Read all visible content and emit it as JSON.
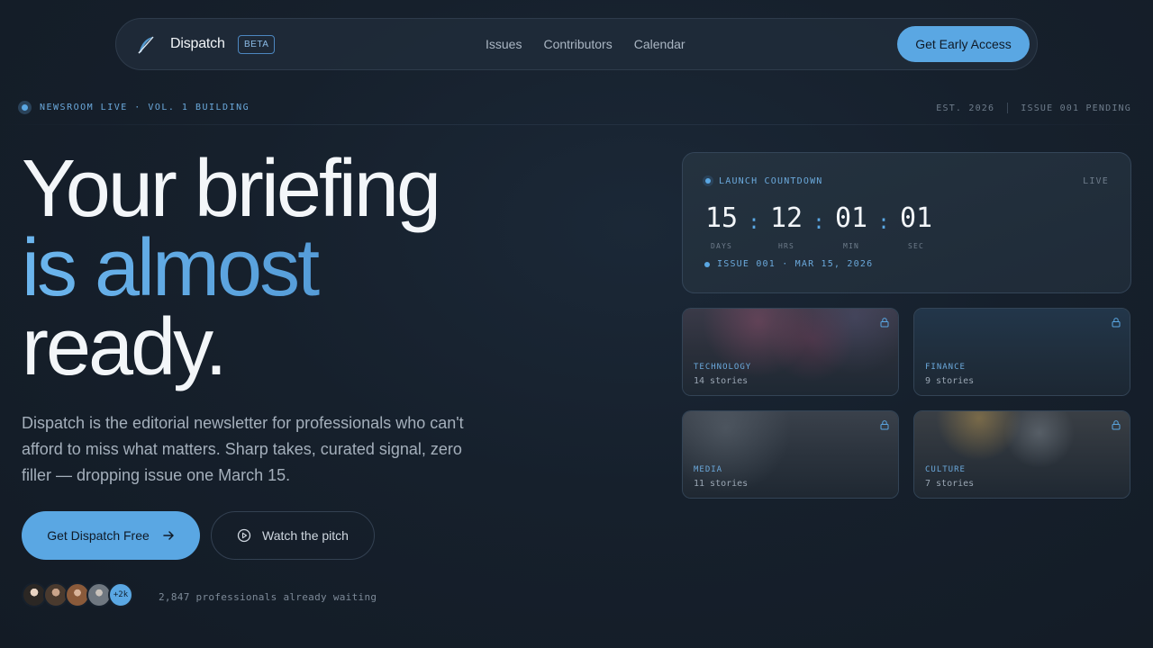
{
  "nav": {
    "brand": "Dispatch",
    "badge": "BETA",
    "links": [
      "Issues",
      "Contributors",
      "Calendar"
    ],
    "cta": "Get Early Access"
  },
  "status": {
    "left": "NEWSROOM LIVE · VOL. 1 BUILDING",
    "est": "EST. 2026",
    "issue": "ISSUE 001 PENDING"
  },
  "hero": {
    "line1": "Your briefing",
    "line2": "is almost",
    "line3": "ready.",
    "description": "Dispatch is the editorial newsletter for professionals who can't afford to miss what matters. Sharp takes, curated signal, zero filler — dropping issue one March 15.",
    "primary_cta": "Get Dispatch Free",
    "secondary_cta": "Watch the pitch",
    "more_count": "+2k",
    "waiting": "2,847 professionals already waiting"
  },
  "countdown": {
    "label": "LAUNCH COUNTDOWN",
    "live": "LIVE",
    "units": [
      {
        "value": "15",
        "label": "DAYS"
      },
      {
        "value": "12",
        "label": "HRS"
      },
      {
        "value": "01",
        "label": "MIN"
      },
      {
        "value": "01",
        "label": "SEC"
      }
    ],
    "issue": "ISSUE 001 · MAR 15, 2026"
  },
  "categories": [
    {
      "name": "TECHNOLOGY",
      "count": "14 stories"
    },
    {
      "name": "FINANCE",
      "count": "9 stories"
    },
    {
      "name": "MEDIA",
      "count": "11 stories"
    },
    {
      "name": "CULTURE",
      "count": "7 stories"
    }
  ],
  "colors": {
    "accent": "#5aa7e3",
    "background": "#16202c",
    "card": "#222f3c"
  }
}
